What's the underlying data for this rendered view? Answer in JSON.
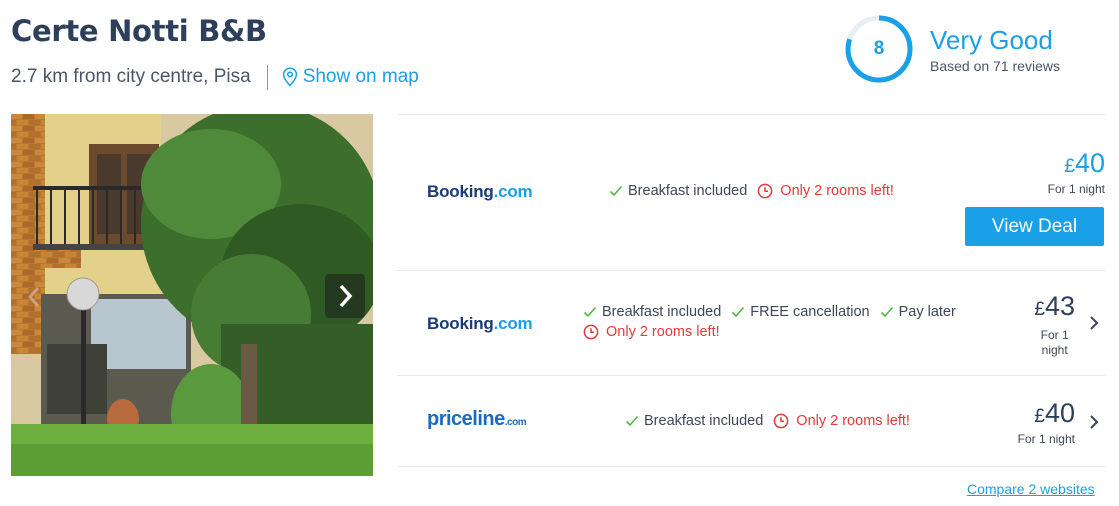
{
  "hotel": {
    "name": "Certe Notti B&B",
    "distance": "2.7 km from city centre, Pisa",
    "map_link": "Show on map"
  },
  "rating": {
    "score": "8",
    "score_fraction": 0.8,
    "label": "Very Good",
    "reviews": "Based on 71 reviews"
  },
  "photo": {
    "next_icon": "chevron-right-icon",
    "prev_icon": "chevron-left-icon"
  },
  "deals": [
    {
      "provider": "Booking.com",
      "provider_parts": [
        "Booking",
        ".com"
      ],
      "features": [
        "Breakfast included"
      ],
      "urgency": "Only 2 rooms left!",
      "currency": "£",
      "price": "40",
      "price_note": "For 1 night",
      "cta": "View Deal",
      "highlighted": true
    },
    {
      "provider": "Booking.com",
      "provider_parts": [
        "Booking",
        ".com"
      ],
      "features": [
        "Breakfast included",
        "FREE cancellation",
        "Pay later"
      ],
      "urgency": "Only 2 rooms left!",
      "currency": "£",
      "price": "43",
      "price_note_lines": [
        "For 1",
        "night"
      ],
      "highlighted": false
    },
    {
      "provider": "priceline.com",
      "provider_parts": [
        "priceline",
        ".com"
      ],
      "features": [
        "Breakfast included"
      ],
      "urgency": "Only 2 rooms left!",
      "currency": "£",
      "price": "40",
      "price_note": "For 1 night",
      "highlighted": false
    }
  ],
  "compare_link": "Compare 2 websites",
  "colors": {
    "accent": "#1aa0e6",
    "title": "#2e3f5c",
    "urgent": "#e03a3a",
    "check": "#4cb944"
  }
}
